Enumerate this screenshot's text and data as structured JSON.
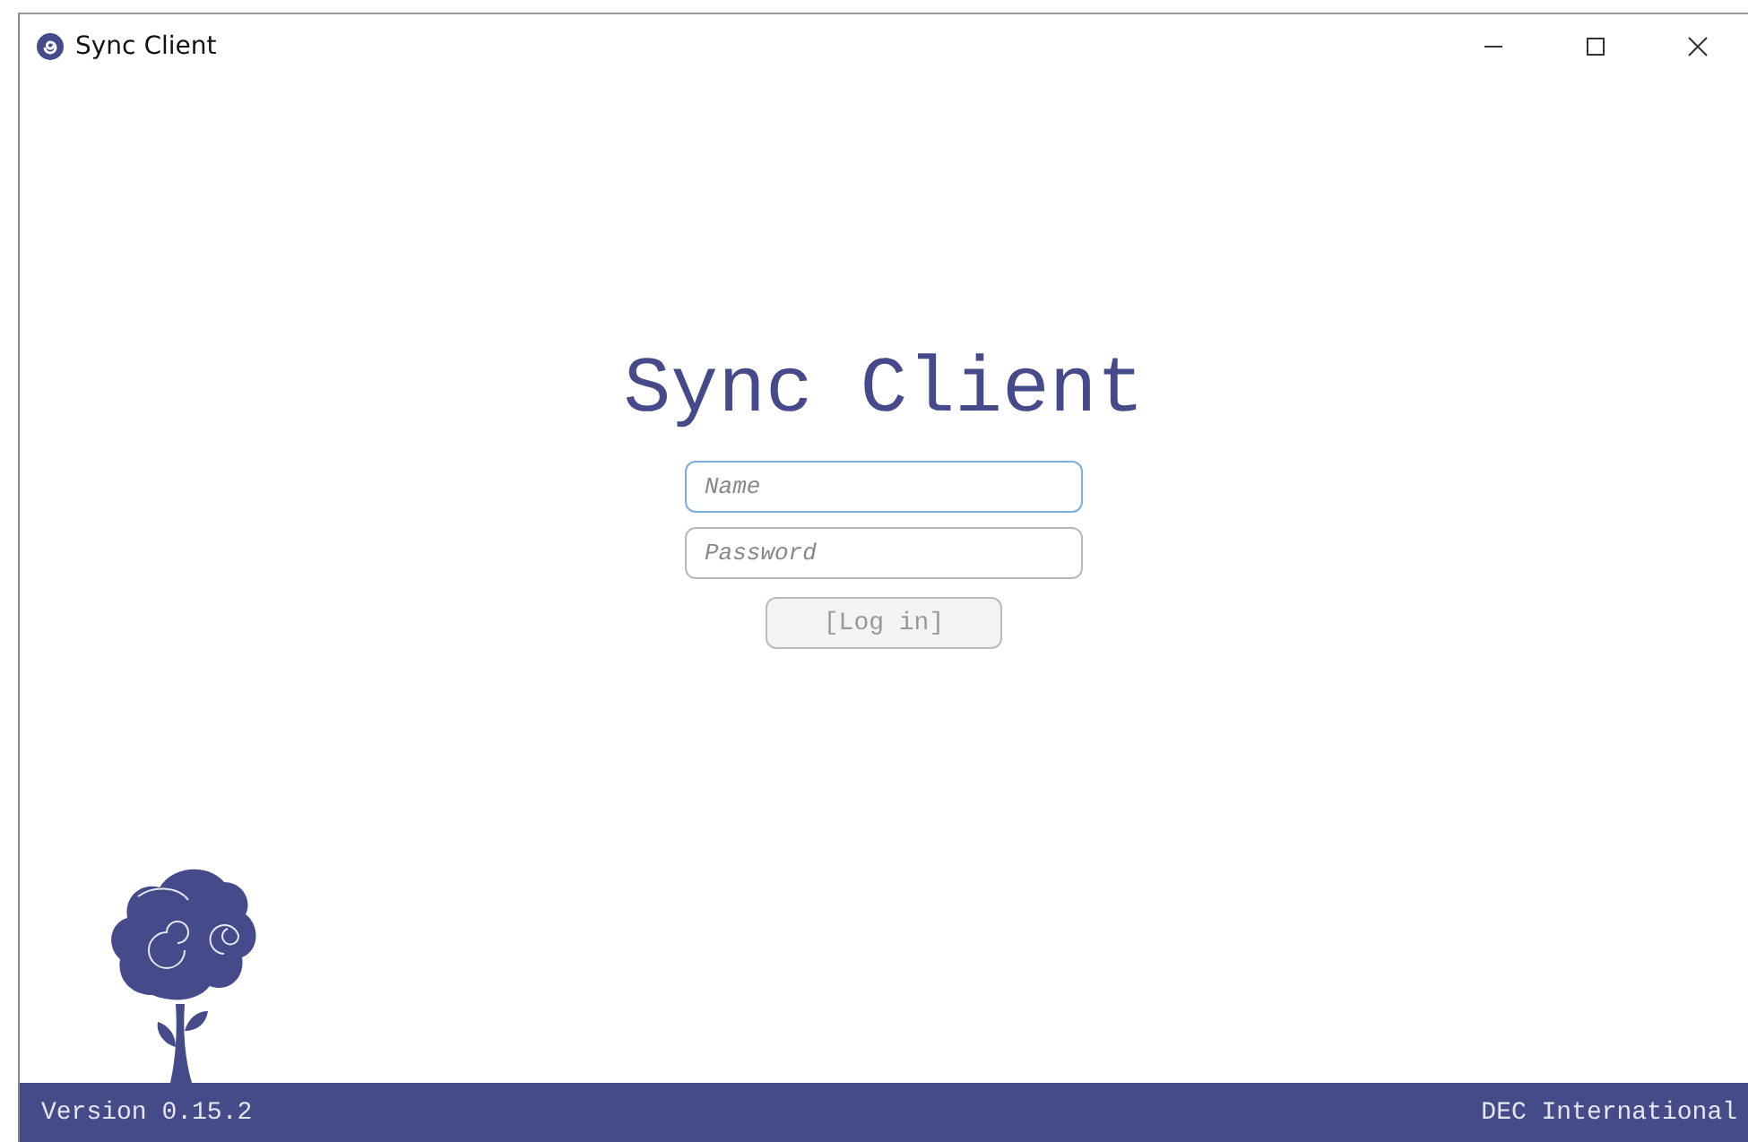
{
  "window": {
    "title": "Sync Client"
  },
  "heading": "Sync Client",
  "fields": [
    {
      "placeholder": "Name",
      "focused": true
    },
    {
      "placeholder": "Password",
      "focused": false
    }
  ],
  "login_button": {
    "label": "[Log in]",
    "disabled": true
  },
  "status_bar": {
    "version": "Version 0.15.2",
    "company": "DEC International"
  }
}
